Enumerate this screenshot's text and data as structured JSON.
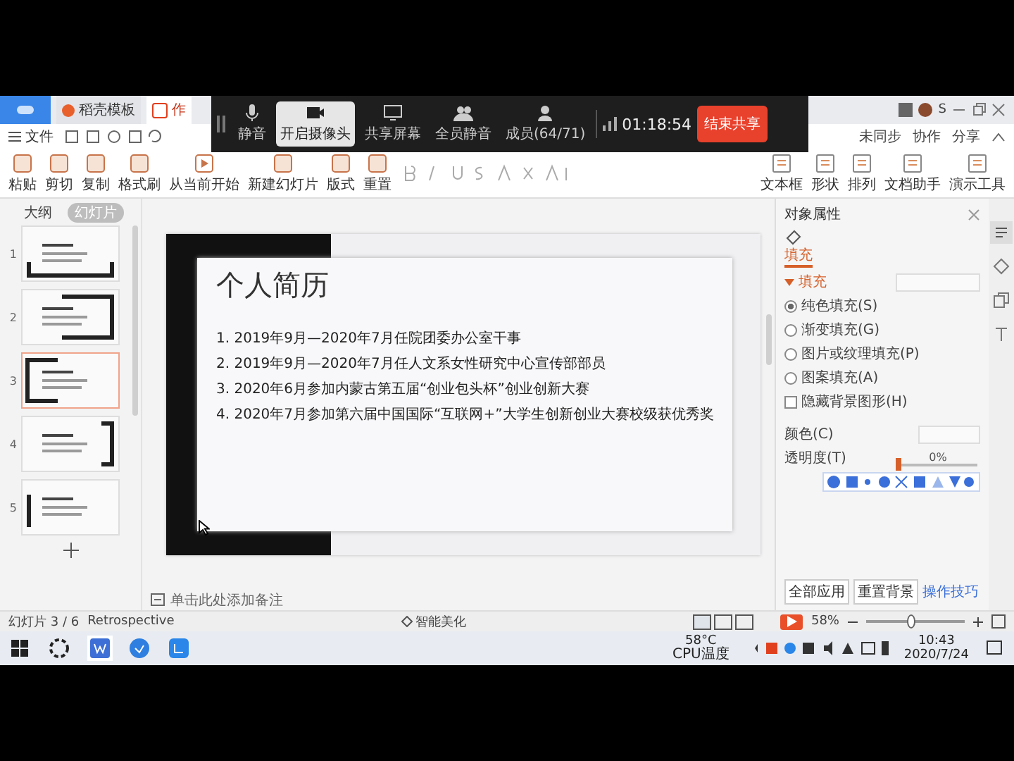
{
  "doc_tabs": [
    {
      "label": "稻壳模板",
      "selected": false
    },
    {
      "label": "作",
      "selected": true
    }
  ],
  "user": {
    "name": "S"
  },
  "meeting_bar": {
    "buttons": [
      {
        "label": "静音",
        "selected": false
      },
      {
        "label": "开启摄像头",
        "selected": true
      },
      {
        "label": "共享屏幕",
        "selected": false
      },
      {
        "label": "全员静音",
        "selected": false
      },
      {
        "label": "成员(64/71)",
        "selected": false
      }
    ],
    "timer": "01:18:54",
    "end_button": "结束共享"
  },
  "menu": {
    "file": "文件"
  },
  "cloud": [
    {
      "label": "未同步"
    },
    {
      "label": "协作"
    },
    {
      "label": "分享"
    }
  ],
  "ribbon": [
    {
      "label": "粘贴"
    },
    {
      "label": "剪切"
    },
    {
      "label": "复制"
    },
    {
      "label": "格式刷"
    },
    {
      "label": "从当前开始"
    },
    {
      "label": "新建幻灯片"
    },
    {
      "label": "版式"
    },
    {
      "label": "重置"
    }
  ],
  "ribbon_right": [
    {
      "label": "文本框"
    },
    {
      "label": "形状"
    },
    {
      "label": "排列"
    },
    {
      "label": "文档助手"
    },
    {
      "label": "演示工具"
    }
  ],
  "slides_panel": {
    "tabs": [
      {
        "label": "大纲",
        "selected": false
      },
      {
        "label": "幻灯片",
        "selected": true
      }
    ],
    "slides": [
      {
        "number": "1",
        "selected": false
      },
      {
        "number": "2",
        "selected": false
      },
      {
        "number": "3",
        "selected": true
      },
      {
        "number": "4",
        "selected": false
      },
      {
        "number": "5",
        "selected": false
      }
    ]
  },
  "slide": {
    "title": "个人简历",
    "items": [
      "1. 2019年9月—2020年7月任院团委办公室干事",
      "2. 2019年9月—2020年7月任人文系女性研究中心宣传部部员",
      "3. 2020年6月参加内蒙古第五届“创业包头杯”创业创新大赛",
      "4. 2020年7月参加第六届中国国际“互联网+”大学生创新创业大赛校级获优秀奖"
    ]
  },
  "notes_placeholder": "单击此处添加备注",
  "properties": {
    "title": "对象属性",
    "tab": "填充",
    "section": "填充",
    "options": [
      {
        "kind": "radio",
        "label": "纯色填充(S)",
        "checked": true
      },
      {
        "kind": "radio",
        "label": "渐变填充(G)",
        "checked": false
      },
      {
        "kind": "radio",
        "label": "图片或纹理填充(P)",
        "checked": false
      },
      {
        "kind": "radio",
        "label": "图案填充(A)",
        "checked": false
      },
      {
        "kind": "checkbox",
        "label": "隐藏背景图形(H)",
        "checked": false
      }
    ],
    "color_label": "颜色(C)",
    "transparency_label": "透明度(T)",
    "transparency_value": "0%",
    "transparency": {
      "level": 0
    },
    "buttons": [
      "全部应用",
      "重置背景"
    ],
    "tips": "操作技巧"
  },
  "status_bar": {
    "slide_counter": "幻灯片 3 / 6",
    "theme": "Retrospective",
    "beautify": "智能美化",
    "zoom": "58%",
    "zoom_slider": {
      "level": 0.45
    }
  },
  "taskbar": {
    "temperature": "58°C",
    "cpu": "CPU温度",
    "time": "10:43",
    "date": "2020/7/24"
  }
}
